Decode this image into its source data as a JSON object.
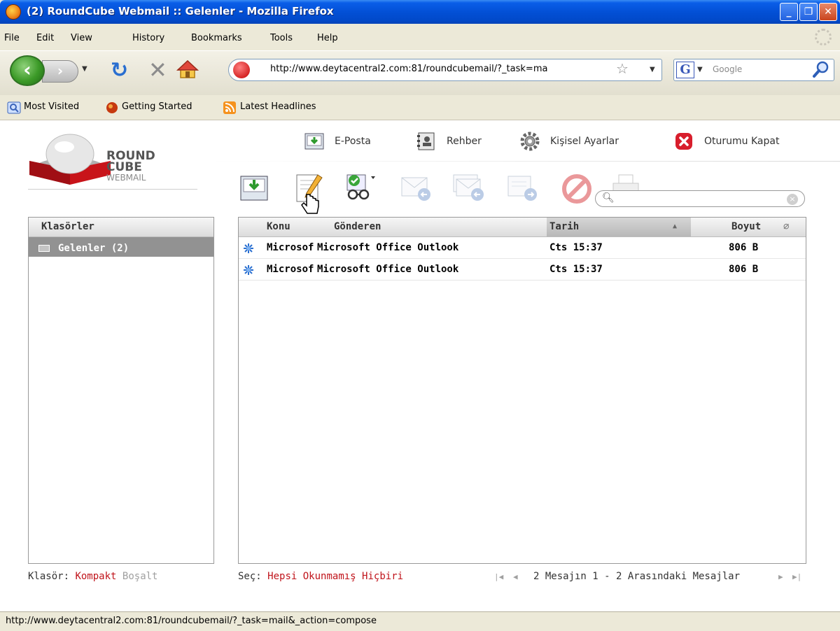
{
  "window": {
    "title": "(2) RoundCube Webmail :: Gelenler - Mozilla Firefox",
    "controls": [
      "minimize",
      "maximize",
      "close"
    ]
  },
  "menu": [
    "File",
    "Edit",
    "View",
    "History",
    "Bookmarks",
    "Tools",
    "Help"
  ],
  "navbar": {
    "url": "http://www.deytacentral2.com:81/roundcubemail/?_task=ma",
    "search_placeholder": "Google",
    "search_engine_letter": "G"
  },
  "bookmarks": [
    "Most Visited",
    "Getting Started",
    "Latest Headlines"
  ],
  "logo": {
    "line1": "ROUND",
    "line2": "CUBE",
    "line3": "WEBMAIL"
  },
  "topnav": {
    "mail": "E-Posta",
    "contacts": "Rehber",
    "settings": "Kişisel Ayarlar",
    "logout": "Oturumu Kapat"
  },
  "folders": {
    "header": "Klasörler",
    "items": [
      {
        "label": "Gelenler (2)",
        "selected": true
      }
    ]
  },
  "messages": {
    "columns": {
      "subject": "Konu",
      "from": "Gönderen",
      "date": "Tarih",
      "size": "Boyut"
    },
    "sort_indicator": "▲",
    "rows": [
      {
        "subject": "Microsof",
        "from": "Microsoft Office Outlook",
        "date": "Cts 15:37",
        "size": "806 B",
        "unread": true
      },
      {
        "subject": "Microsof",
        "from": "Microsoft Office Outlook",
        "date": "Cts 15:37",
        "size": "806 B",
        "unread": true
      }
    ]
  },
  "footer": {
    "folder_label": "Klasör:",
    "compact": "Kompakt",
    "empty": "Boşalt",
    "select_label": "Seç:",
    "select_all": "Hepsi",
    "select_unread": "Okunmamış",
    "select_none": "Hiçbiri",
    "count_text": "2 Mesajın 1 - 2 Arasındaki Mesajlar"
  },
  "statusbar": "http://www.deytacentral2.com:81/roundcubemail/?_task=mail&_action=compose",
  "colors": {
    "titlebar": "#0350d6",
    "accent_red": "#c0141b",
    "selected_folder": "#929292"
  }
}
